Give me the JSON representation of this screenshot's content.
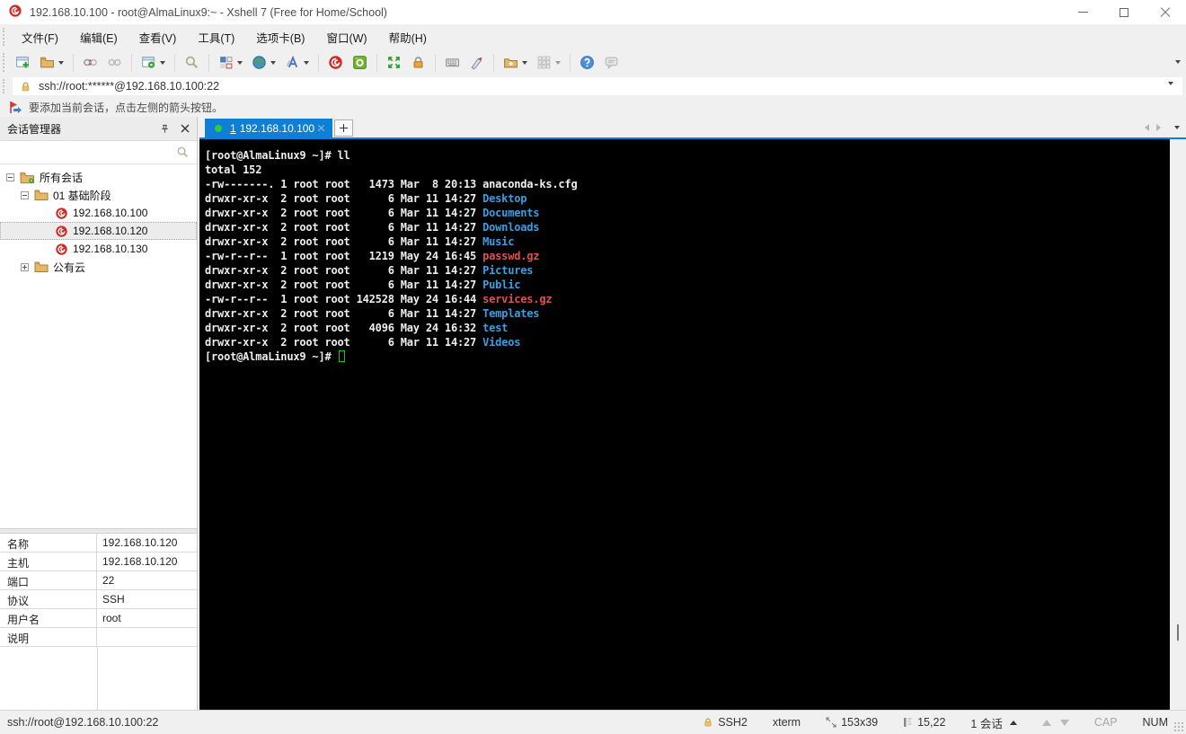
{
  "window": {
    "title": "192.168.10.100 - root@AlmaLinux9:~ - Xshell 7 (Free for Home/School)"
  },
  "menu": {
    "items": [
      "文件(F)",
      "编辑(E)",
      "查看(V)",
      "工具(T)",
      "选项卡(B)",
      "窗口(W)",
      "帮助(H)"
    ]
  },
  "toolbar": {
    "icons": [
      "new-session-icon",
      "open-session-icon",
      "disconnect-icon",
      "reconnect-icon",
      "session-properties-icon",
      "find-icon",
      "layout-icon",
      "encoding-globe-icon",
      "font-icon",
      "xshell-icon",
      "xftp-icon",
      "fullscreen-icon",
      "lock-screen-icon",
      "virtual-keyboard-icon",
      "compose-pen-icon",
      "new-file-icon",
      "screen-grid-icon",
      "help-icon",
      "feedback-icon",
      "toolbar-overflow-icon"
    ]
  },
  "address_bar": {
    "url": "ssh://root:******@192.168.10.100:22"
  },
  "info_bar": {
    "text": "要添加当前会话，点击左侧的箭头按钮。"
  },
  "session_manager": {
    "title": "会话管理器",
    "tree": {
      "root_label": "所有会话",
      "group_label": "01 基础阶段",
      "sessions": [
        "192.168.10.100",
        "192.168.10.120",
        "192.168.10.130"
      ],
      "collapsed_group_label": "公有云",
      "selected_session": "192.168.10.120"
    },
    "properties": {
      "rows": [
        {
          "label": "名称",
          "value": "192.168.10.120"
        },
        {
          "label": "主机",
          "value": "192.168.10.120"
        },
        {
          "label": "端口",
          "value": "22"
        },
        {
          "label": "协议",
          "value": "SSH"
        },
        {
          "label": "用户名",
          "value": "root"
        },
        {
          "label": "说明",
          "value": ""
        }
      ]
    }
  },
  "tabs": {
    "active": {
      "index": "1",
      "label": "192.168.10.100",
      "status_color": "#2ecc40"
    }
  },
  "terminal": {
    "colors": {
      "background": "#000000",
      "text": "#eeeeee",
      "directory": "#3b9fe3",
      "archive": "#e05252",
      "cursor": "#00cc22",
      "tab_accent": "#0f7fd5"
    },
    "lines": [
      {
        "text": "[root@AlmaLinux9 ~]# ll"
      },
      {
        "text": "total 152"
      },
      {
        "prefix": "-rw-------. 1 root root   1473 Mar  8 20:13 ",
        "name": "anaconda-ks.cfg"
      },
      {
        "prefix": "drwxr-xr-x  2 root root      6 Mar 11 14:27 ",
        "name": "Desktop"
      },
      {
        "prefix": "drwxr-xr-x  2 root root      6 Mar 11 14:27 ",
        "name": "Documents"
      },
      {
        "prefix": "drwxr-xr-x  2 root root      6 Mar 11 14:27 ",
        "name": "Downloads"
      },
      {
        "prefix": "drwxr-xr-x  2 root root      6 Mar 11 14:27 ",
        "name": "Music"
      },
      {
        "prefix": "-rw-r--r--  1 root root   1219 May 24 16:45 ",
        "name": "passwd.gz"
      },
      {
        "prefix": "drwxr-xr-x  2 root root      6 Mar 11 14:27 ",
        "name": "Pictures"
      },
      {
        "prefix": "drwxr-xr-x  2 root root      6 Mar 11 14:27 ",
        "name": "Public"
      },
      {
        "prefix": "-rw-r--r--  1 root root 142528 May 24 16:44 ",
        "name": "services.gz"
      },
      {
        "prefix": "drwxr-xr-x  2 root root      6 Mar 11 14:27 ",
        "name": "Templates"
      },
      {
        "prefix": "drwxr-xr-x  2 root root   4096 May 24 16:32 ",
        "name": "test"
      },
      {
        "prefix": "drwxr-xr-x  2 root root      6 Mar 11 14:27 ",
        "name": "Videos"
      },
      {
        "text": "[root@AlmaLinux9 ~]# "
      }
    ]
  },
  "status_bar": {
    "connection": "ssh://root@192.168.10.100:22",
    "protocol": "SSH2",
    "terminal_type": "xterm",
    "screen_size": "153x39",
    "cursor_position": "15,22",
    "session_count": "1 会话",
    "caps_indicator": "CAP",
    "num_indicator": "NUM"
  }
}
